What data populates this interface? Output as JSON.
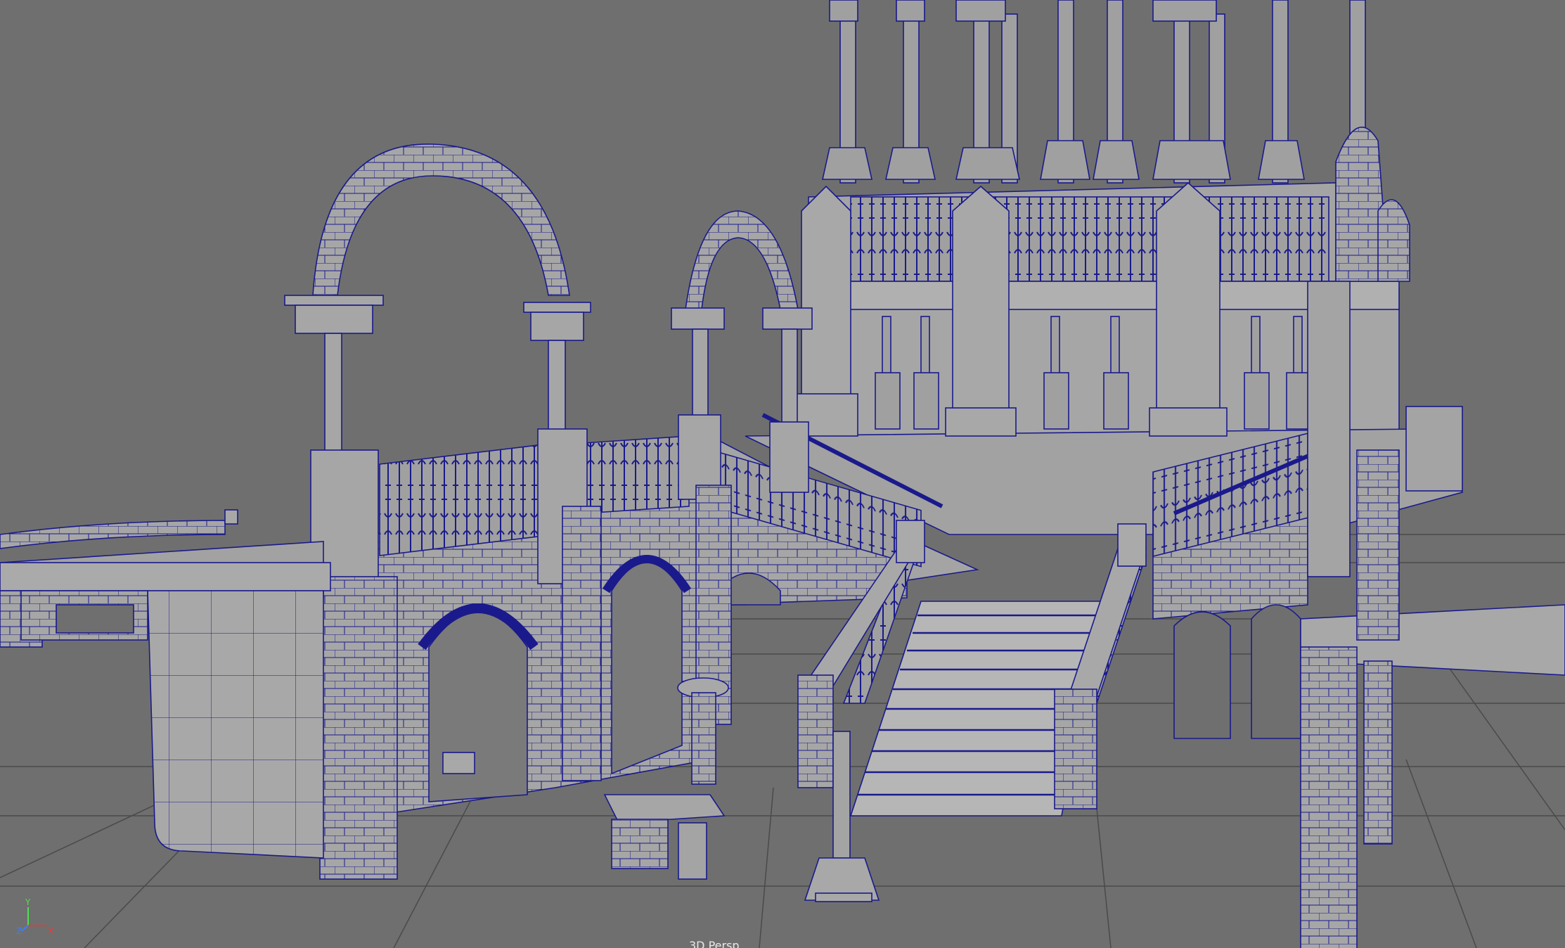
{
  "viewport": {
    "camera_label": "3D Persp",
    "background": "#6f6f6f",
    "wire_color": "#1a1a8c",
    "surface_color": "#a4a4a4"
  },
  "axis_gizmo": {
    "y": "Y",
    "z": "Z",
    "x": "X",
    "y_color": "#4ee04e",
    "z_color": "#3a7fff",
    "x_color": "#ff3333"
  }
}
